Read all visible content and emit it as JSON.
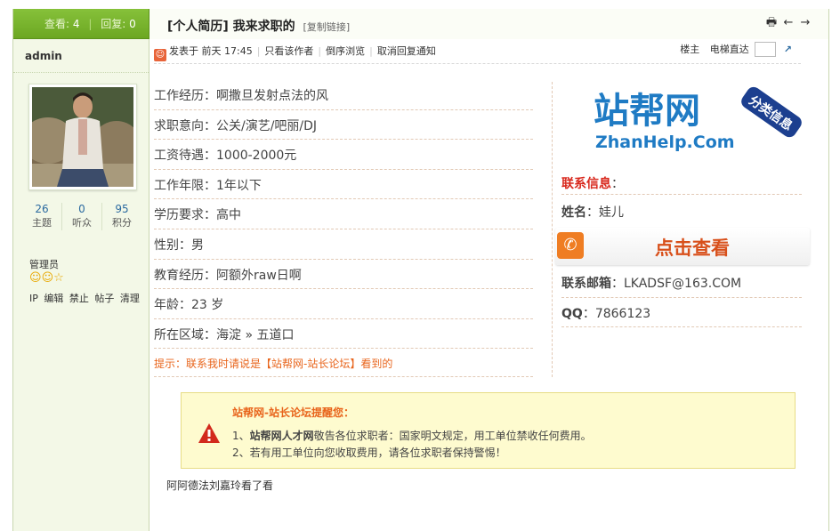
{
  "header": {
    "views_label": "查看:",
    "views": "4",
    "replies_label": "回复:",
    "replies": "0",
    "title": "[个人简历] 我来求职的",
    "copy_link": "[复制链接]"
  },
  "sidebar": {
    "username": "admin",
    "stats": [
      {
        "value": "26",
        "label": "主题"
      },
      {
        "value": "0",
        "label": "听众"
      },
      {
        "value": "95",
        "label": "积分"
      }
    ],
    "role": "管理员",
    "admin_links": [
      "IP",
      "编辑",
      "禁止",
      "帖子",
      "清理"
    ]
  },
  "meta": {
    "posted": "发表于 前天 17:45",
    "only_author": "只看该作者",
    "reverse": "倒序浏览",
    "cancel_notify": "取消回复通知",
    "floor": "楼主",
    "elevator": "电梯直达"
  },
  "details": [
    "工作经历：啊撒旦发射点法的风",
    "求职意向：公关/演艺/吧丽/DJ",
    "工资待遇：1000-2000元",
    "工作年限：1年以下",
    "学历要求：高中",
    "性别：男",
    "教育经历：阿额外raw日啊",
    "年龄：23 岁",
    "所在区域：海淀 » 五道口"
  ],
  "tip": "提示：联系我时请说是【站帮网-站长论坛】看到的",
  "logo": {
    "text": "站帮网",
    "domain": "ZhanHelp.Com",
    "badge": "分类信息"
  },
  "contact": {
    "heading": "联系信息",
    "name_label": "姓名",
    "name": "娃儿",
    "reveal_button": "点击查看",
    "email_label": "联系邮箱",
    "email": "LKADSF@163.COM",
    "qq_label": "QQ",
    "qq": "7866123"
  },
  "notice": {
    "title": "站帮网-站长论坛提醒您：",
    "line1_prefix": "1、",
    "line1_brand": "站帮网人才网",
    "line1_rest": "敬告各位求职者：国家明文规定，用工单位禁收任何费用。",
    "line2": "2、若有用工单位向您收取费用，请各位求职者保持警惕！"
  },
  "reply_text": "阿阿德法刘嘉玲看了看",
  "colors": {
    "header_green": "#6ca722",
    "accent_orange": "#e8641b",
    "contact_red": "#d8271c",
    "logo_blue": "#1f7bc4",
    "logo_green": "#3aa535"
  }
}
